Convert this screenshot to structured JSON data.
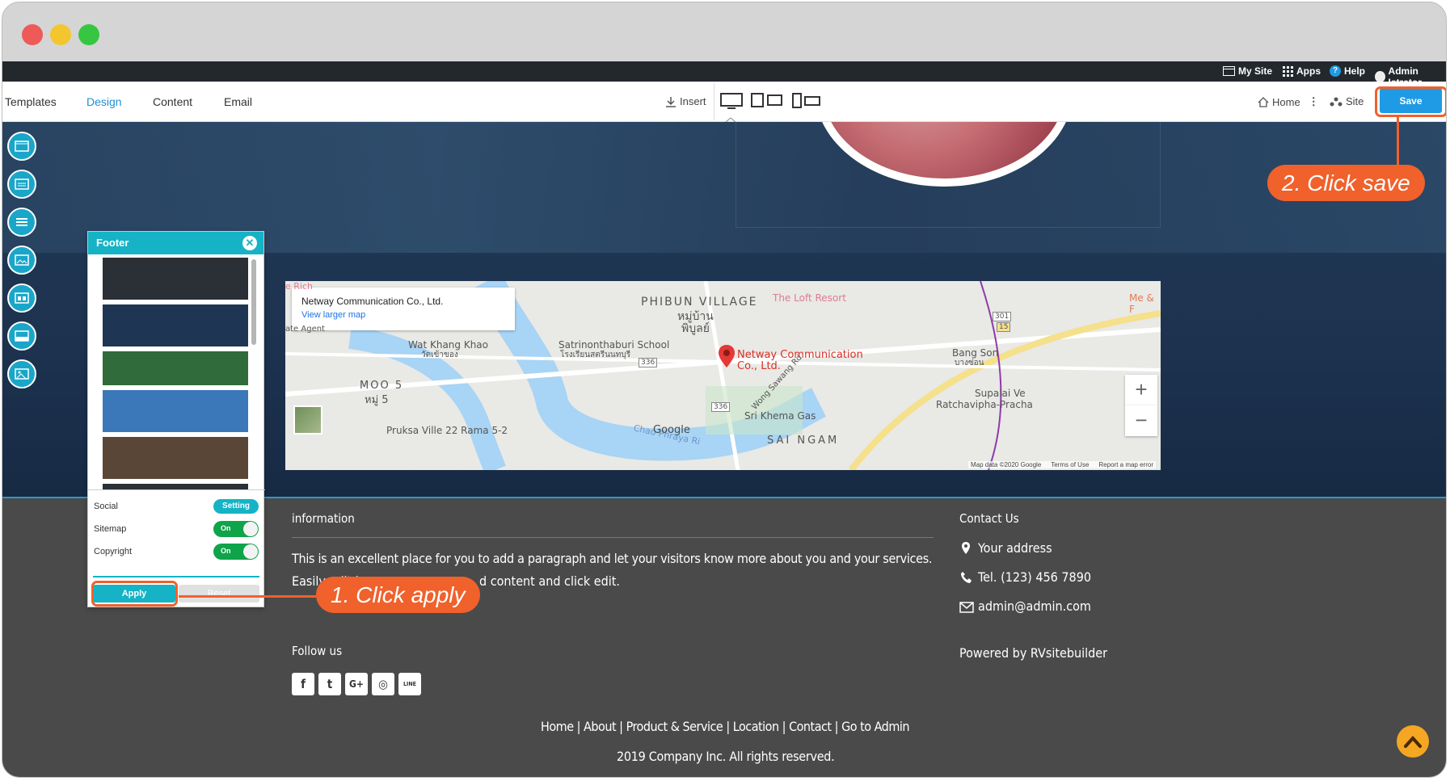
{
  "window": {
    "controls": [
      {
        "name": "close",
        "color": "#ee5a57"
      },
      {
        "name": "minimize",
        "color": "#f3c62f"
      },
      {
        "name": "maximize",
        "color": "#37c642"
      }
    ]
  },
  "admin_bar": {
    "my_site": "My Site",
    "apps": "Apps",
    "help": "Help",
    "user": "Admin Istrator"
  },
  "toolbar": {
    "tabs": [
      "Templates",
      "Design",
      "Content",
      "Email"
    ],
    "active_tab": "Design",
    "insert": "Insert",
    "home": "Home",
    "site": "Site",
    "save": "Save"
  },
  "map": {
    "place_name": "Netway Communication Co., Ltd.",
    "view_larger": "View larger map",
    "pin_label_1": "Netway Communication",
    "pin_label_2": "Co., Ltd.",
    "labels": {
      "phibun": "PHIBUN VILLAGE",
      "phibun_th": "หมู่บ้าน",
      "phibun_th2": "พิบูลย์",
      "loft": "The Loft Resort",
      "wat": "Wat Khang Khao",
      "wat_th": "วัดเข้าของ",
      "school": "Satrinonthaburi School",
      "school_th": "โรงเรียนสตรีนนทบุรี",
      "moo": "MOO 5",
      "moo_th": "หมู่ 5",
      "pruksa": "Pruksa Ville 22 Rama 5-2",
      "sri_khema": "Sri Khema Gas",
      "sai_ngam": "SAI NGAM",
      "bang_son": "Bang Son",
      "bang_son_th": "บางซ่อน",
      "supalai": "Supalai Ve",
      "ratchavipha": "Ratchavipha-Pracha",
      "chao_phraya": "Chao Phraya Ri",
      "wong_sawang": "Wong Sawang Rd",
      "me": "Me & F",
      "rich": "e Rich",
      "agent": "ate Agent",
      "google": "Google",
      "route_1": "336",
      "route_2": "336",
      "route_3": "301",
      "route_4": "15"
    },
    "attribution": [
      "Map data ©2020 Google",
      "Terms of Use",
      "Report a map error"
    ],
    "zoom_in": "+",
    "zoom_out": "−"
  },
  "footer": {
    "info_heading": "information",
    "info_text_1": "This is an excellent place for you to add a paragraph and let your visitors know more about you and your services.",
    "info_text_2a": "Easily edit by",
    "info_text_2b": "d content and click edit.",
    "follow_heading": "Follow us",
    "social": [
      {
        "icon": "facebook-icon",
        "glyph": "f"
      },
      {
        "icon": "twitter-icon",
        "glyph": "t"
      },
      {
        "icon": "google-plus-icon",
        "glyph": "G+"
      },
      {
        "icon": "instagram-icon",
        "glyph": "◎"
      },
      {
        "icon": "line-icon",
        "glyph": "LINE"
      }
    ],
    "contact_heading": "Contact Us",
    "address": "Your address",
    "tel": "Tel. (123) 456 7890",
    "email": "admin@admin.com",
    "powered": "Powered by RVsitebuilder",
    "links": "Home | About | Product & Service | Location | Contact | Go to Admin",
    "copyright": "2019 Company Inc. All rights reserved."
  },
  "footer_panel": {
    "title": "Footer",
    "options": [
      {
        "label": "Social",
        "control": "Setting"
      },
      {
        "label": "Sitemap",
        "control": "On"
      },
      {
        "label": "Copyright",
        "control": "On"
      }
    ],
    "apply": "Apply",
    "reset": "Reset",
    "thumbnails": [
      {
        "bg": "#2b2f36"
      },
      {
        "bg": "#1f3554"
      },
      {
        "bg": "#2f6b3b"
      },
      {
        "bg": "#3b78b9"
      },
      {
        "bg": "#5a4636"
      }
    ]
  },
  "callouts": {
    "apply": "1. Click apply",
    "save": "2. Click save"
  },
  "colors": {
    "accent": "#1e9be4",
    "panel": "#15b3c5",
    "callout": "#f0612c",
    "footer_bg": "#4a4a4a",
    "scroll_top": "#f5a623"
  }
}
